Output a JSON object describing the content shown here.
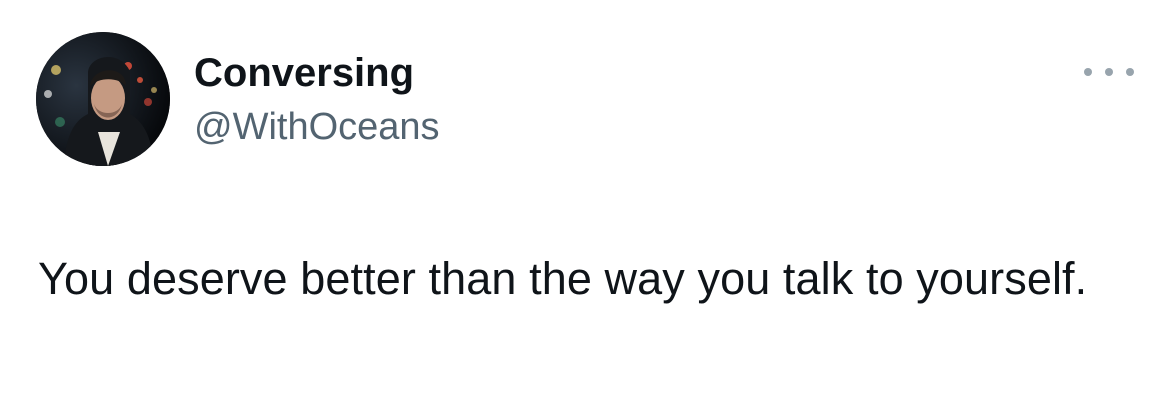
{
  "tweet": {
    "author": {
      "display_name": "Conversing",
      "handle": "@WithOceans",
      "avatar_icon": "profile-photo"
    },
    "more_icon": "more-horizontal-icon",
    "text": "You deserve better than the way you talk to yourself."
  },
  "colors": {
    "text_primary": "#0f1419",
    "text_secondary": "#536471",
    "icon_muted": "#98a4ad",
    "background": "#ffffff"
  }
}
